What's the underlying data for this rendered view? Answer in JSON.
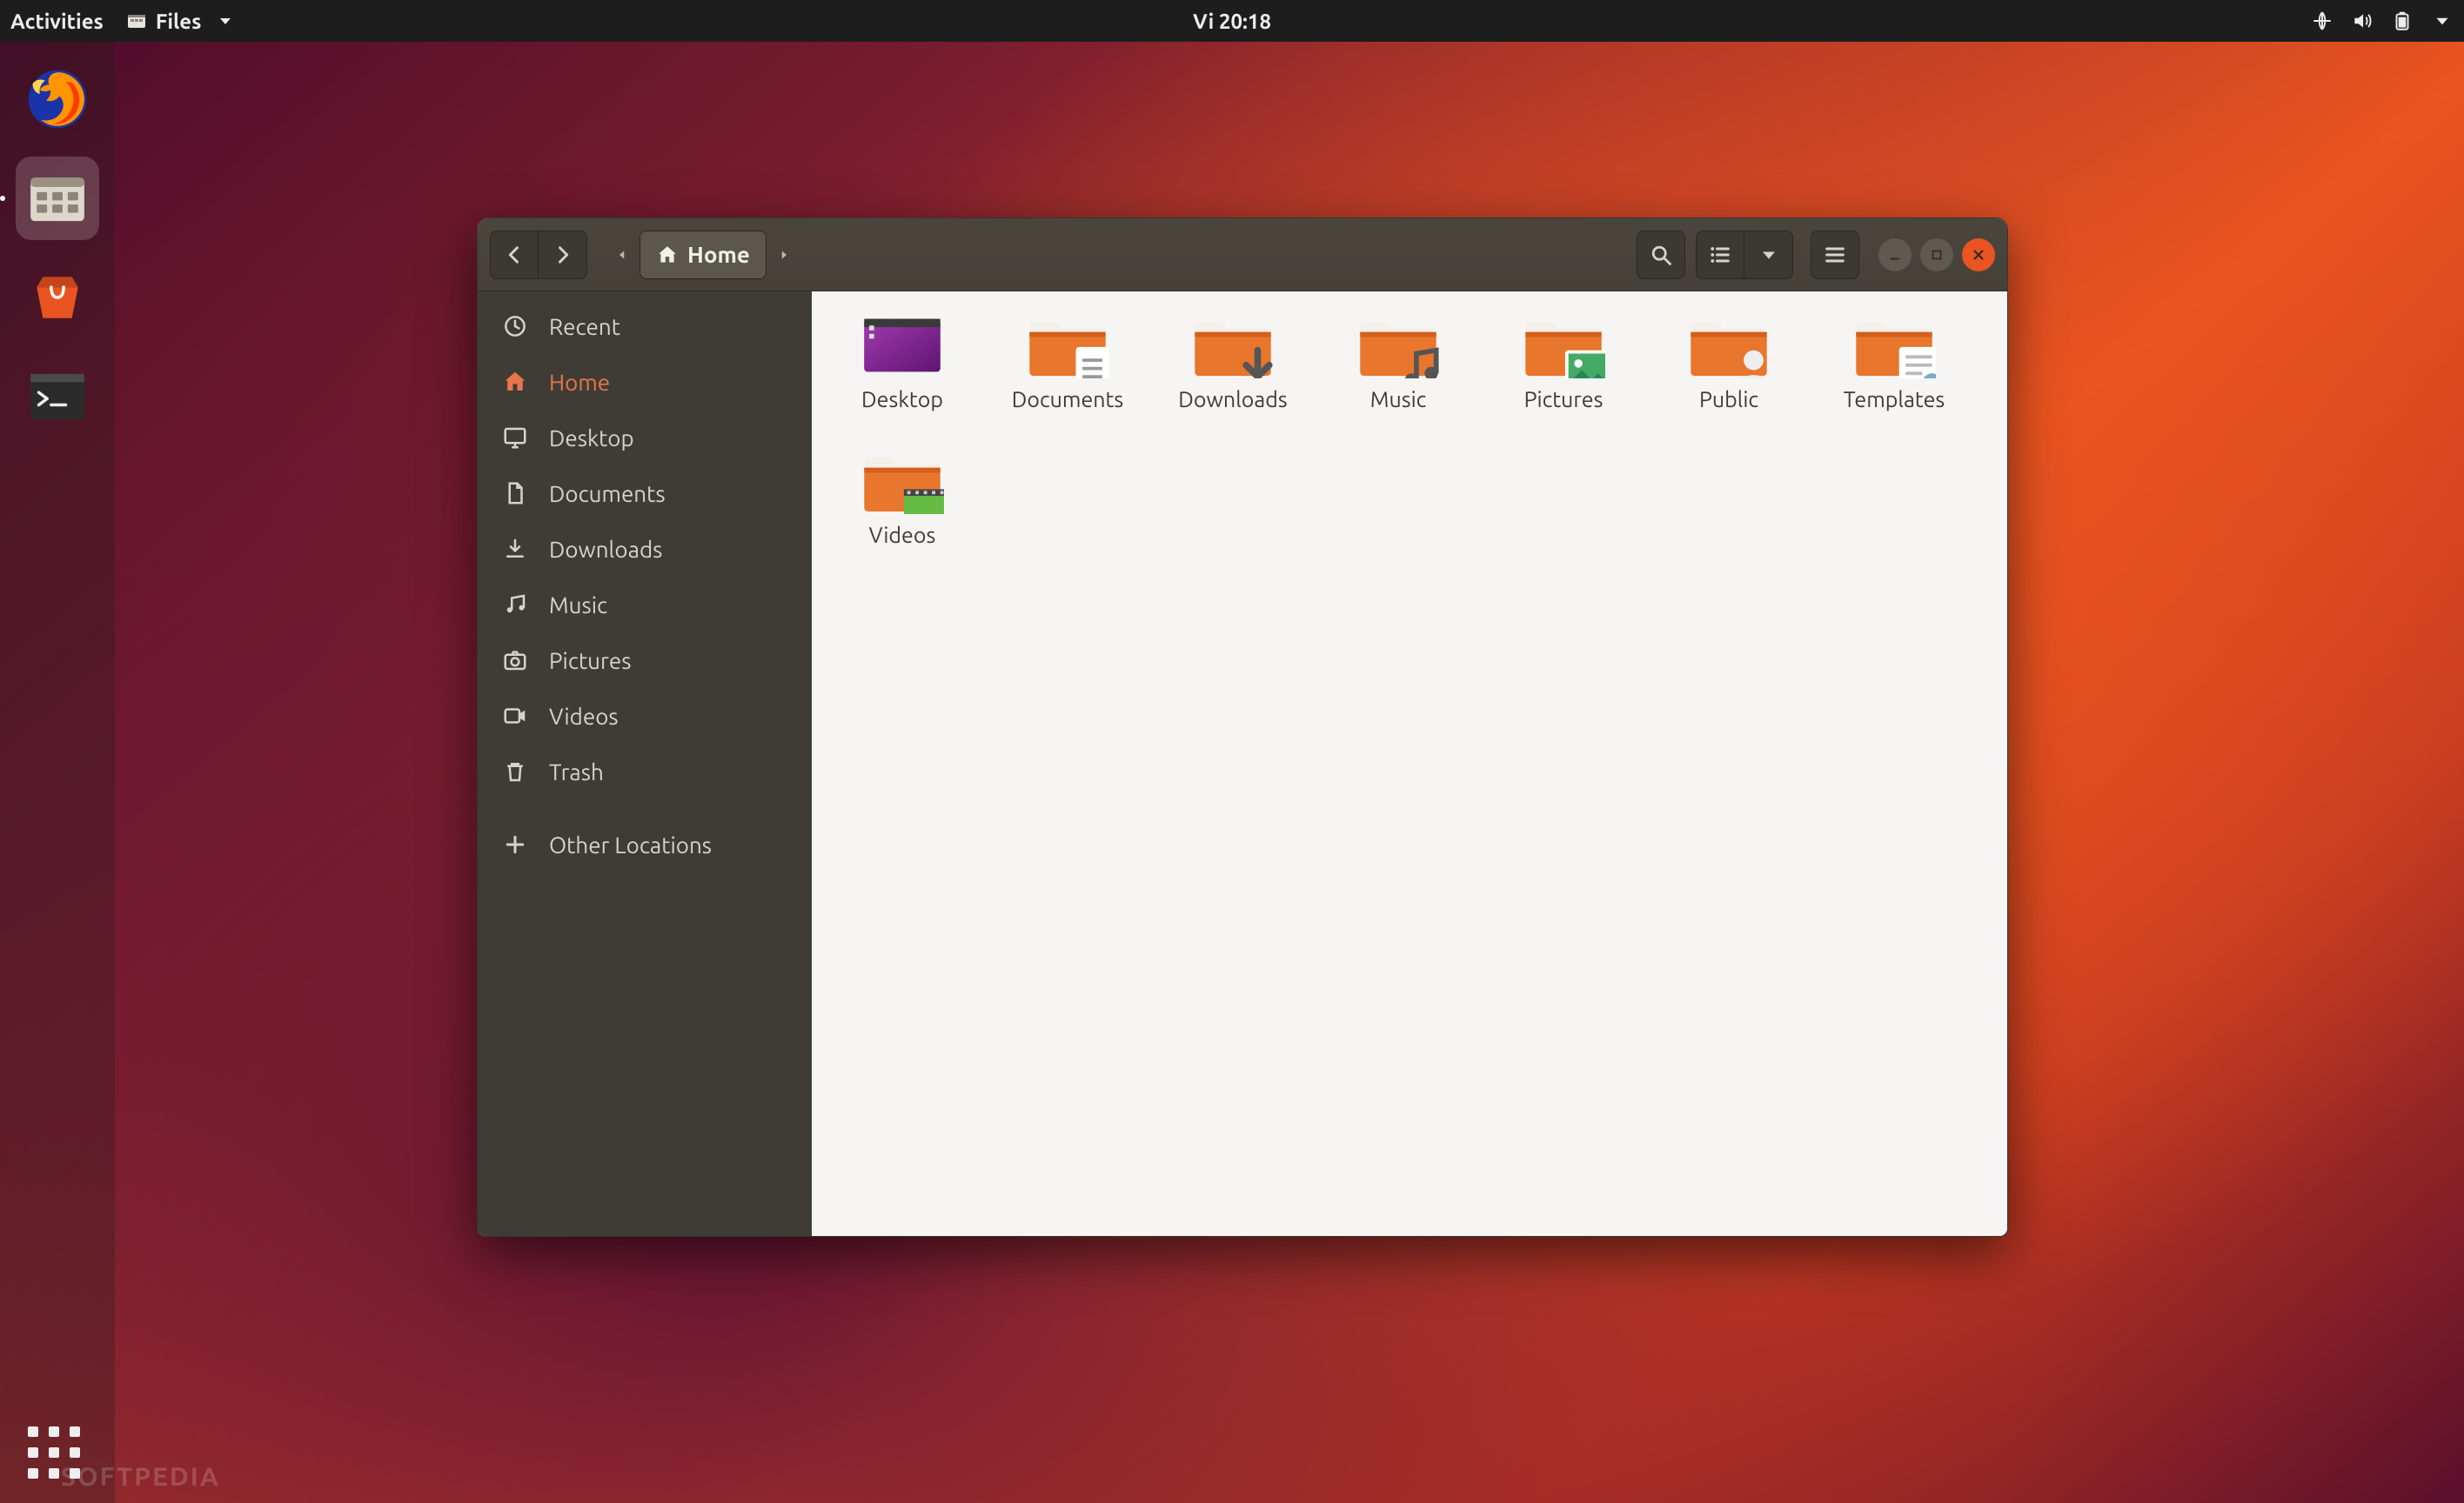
{
  "topbar": {
    "activities": "Activities",
    "app_name": "Files",
    "clock": "Vi 20:18"
  },
  "dock": {
    "items": [
      {
        "name": "firefox"
      },
      {
        "name": "files",
        "active": true
      },
      {
        "name": "software"
      },
      {
        "name": "terminal"
      }
    ]
  },
  "watermark": "SOFTPEDIA",
  "window": {
    "path_label": "Home",
    "sidebar": [
      {
        "icon": "recent",
        "label": "Recent"
      },
      {
        "icon": "home",
        "label": "Home",
        "active": true
      },
      {
        "icon": "desktop",
        "label": "Desktop"
      },
      {
        "icon": "documents",
        "label": "Documents"
      },
      {
        "icon": "downloads",
        "label": "Downloads"
      },
      {
        "icon": "music",
        "label": "Music"
      },
      {
        "icon": "pictures",
        "label": "Pictures"
      },
      {
        "icon": "videos",
        "label": "Videos"
      },
      {
        "icon": "trash",
        "label": "Trash"
      },
      {
        "icon": "other",
        "label": "Other Locations",
        "sep_before": true
      }
    ],
    "items": [
      {
        "type": "desktop",
        "label": "Desktop"
      },
      {
        "type": "documents",
        "label": "Documents"
      },
      {
        "type": "downloads",
        "label": "Downloads"
      },
      {
        "type": "music",
        "label": "Music"
      },
      {
        "type": "pictures",
        "label": "Pictures"
      },
      {
        "type": "public",
        "label": "Public"
      },
      {
        "type": "templates",
        "label": "Templates"
      },
      {
        "type": "videos",
        "label": "Videos"
      }
    ]
  },
  "colors": {
    "accent": "#e95420",
    "folder": "#e8762c",
    "folder_dark": "#c85a18"
  }
}
